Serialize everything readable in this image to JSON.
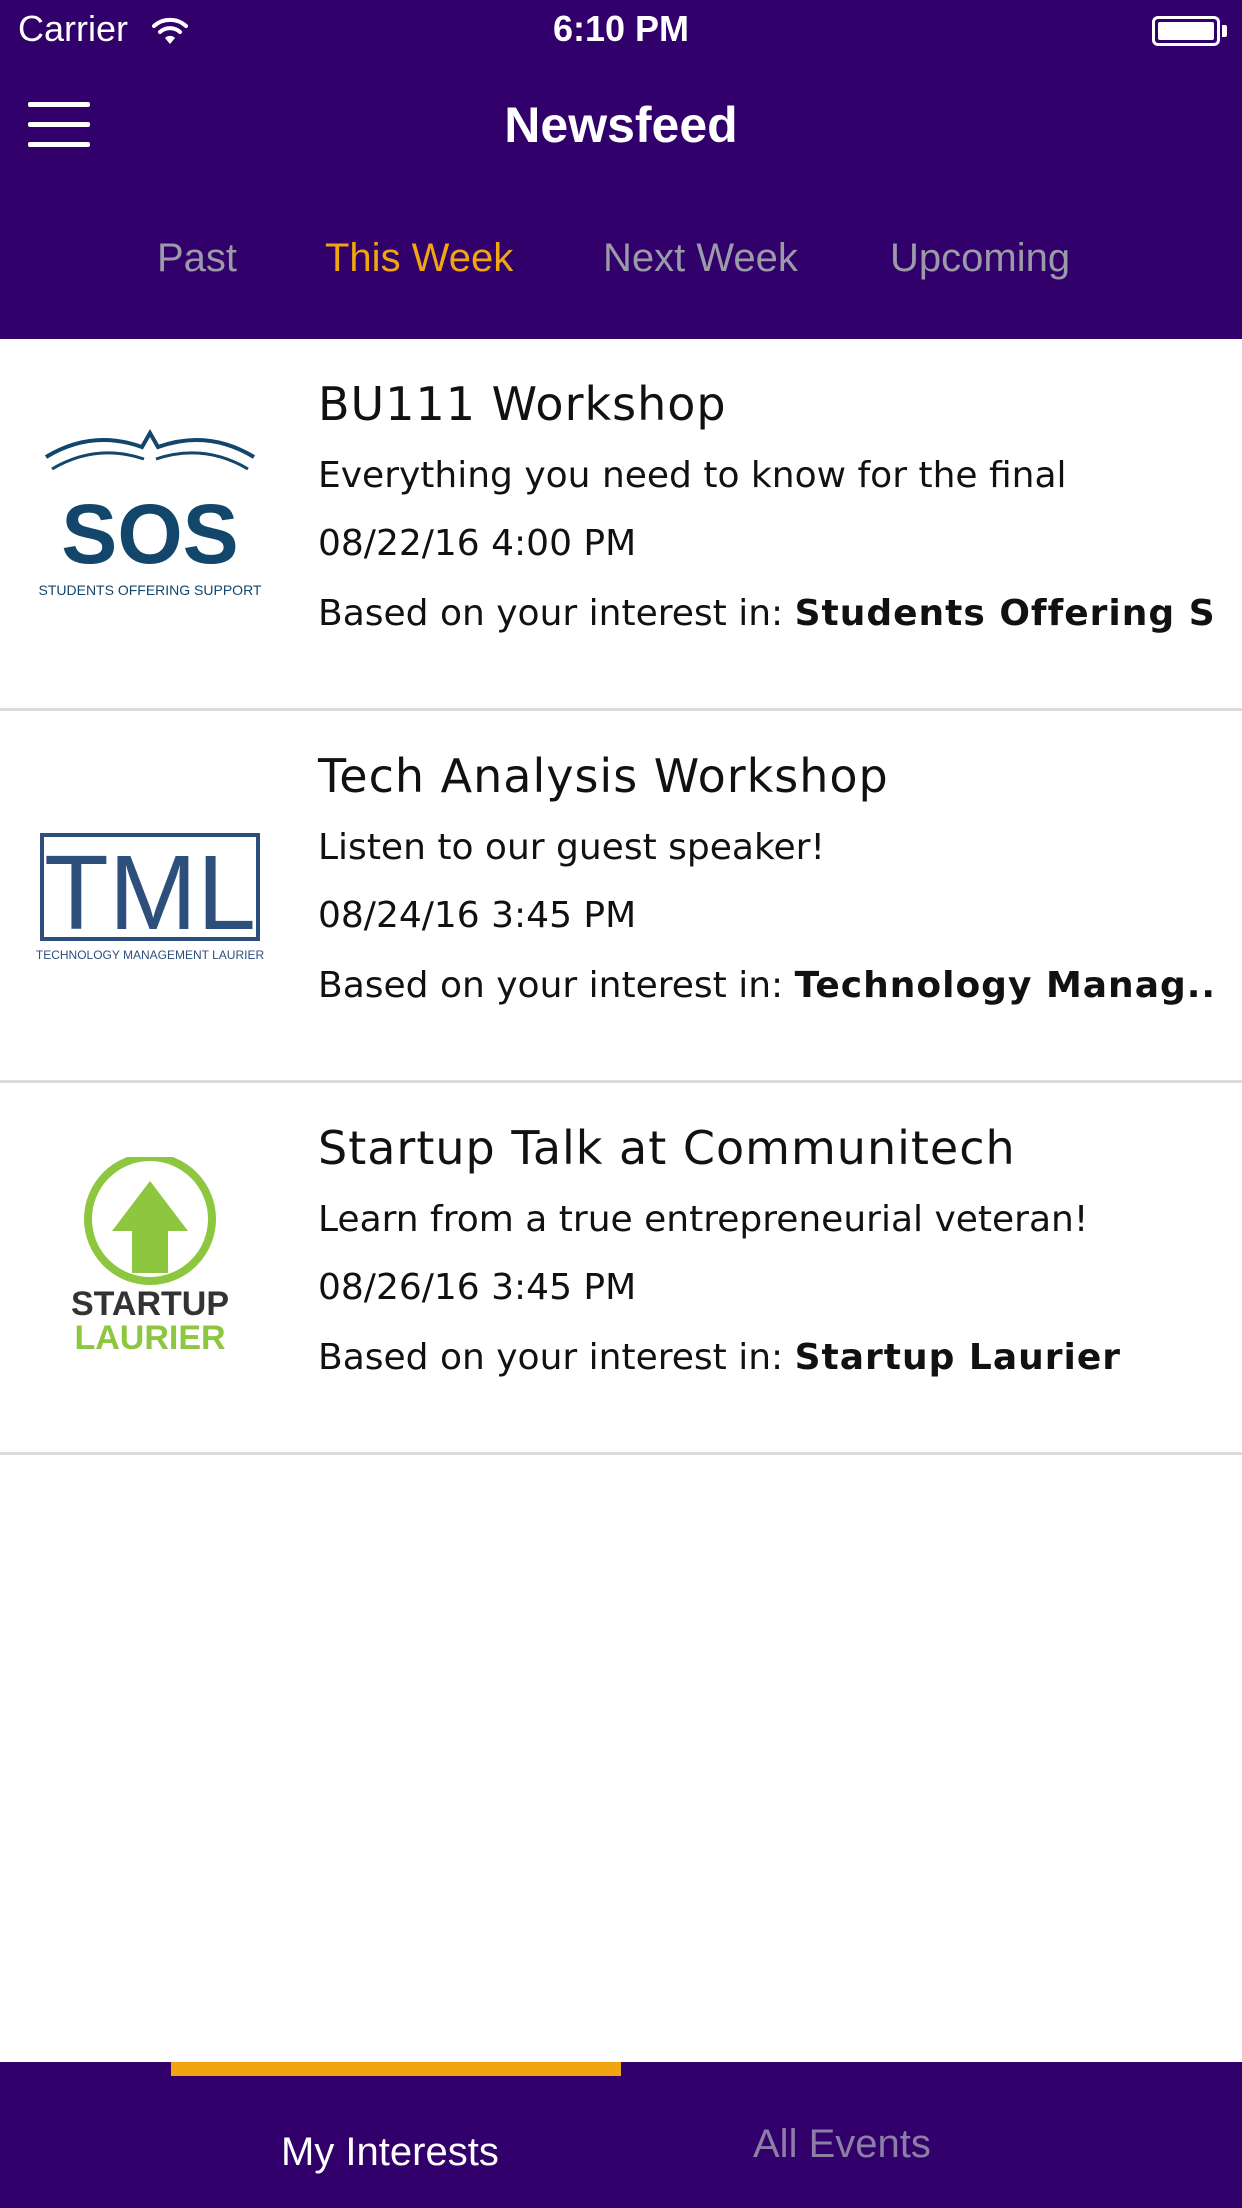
{
  "status_bar": {
    "carrier": "Carrier",
    "time": "6:10 PM"
  },
  "header": {
    "title": "Newsfeed",
    "menu_icon": "hamburger-menu-icon"
  },
  "tabs": [
    {
      "label": "Past",
      "active": false
    },
    {
      "label": "This Week",
      "active": true
    },
    {
      "label": "Next Week",
      "active": false
    },
    {
      "label": "Upcoming",
      "active": false
    }
  ],
  "feed": [
    {
      "title": "BU111 Workshop",
      "description": "Everything you need to know for the final",
      "datetime": "08/22/16 4:00 PM",
      "interest_prefix": "Based on your interest in: ",
      "interest": "Students Offering S...",
      "logo": {
        "name": "sos-logo",
        "text": "SOS",
        "subtext": "STUDENTS OFFERING SUPPORT"
      }
    },
    {
      "title": "Tech Analysis Workshop",
      "description": "Listen to our guest speaker!",
      "datetime": "08/24/16 3:45 PM",
      "interest_prefix": "Based on your interest in: ",
      "interest": "Technology Manag...",
      "logo": {
        "name": "tml-logo",
        "text": "TML",
        "subtext": "TECHNOLOGY MANAGEMENT LAURIER"
      }
    },
    {
      "title": "Startup Talk at Communitech",
      "description": "Learn from a true entrepreneurial veteran!",
      "datetime": "08/26/16 3:45 PM",
      "interest_prefix": "Based on your interest in: ",
      "interest": "Startup Laurier",
      "logo": {
        "name": "startup-laurier-logo",
        "text": "STARTUP",
        "subtext": "LAURIER"
      }
    }
  ],
  "bottom_tabs": [
    {
      "label": "My Interests",
      "active": true
    },
    {
      "label": "All Events",
      "active": false
    }
  ],
  "colors": {
    "brand_purple": "#31006a",
    "accent_gold": "#f1a60f",
    "inactive_tab": "#9b9aa8",
    "sos_navy": "#13466b",
    "tml_blue": "#2c4f7c",
    "startup_green": "#8dc63f"
  }
}
